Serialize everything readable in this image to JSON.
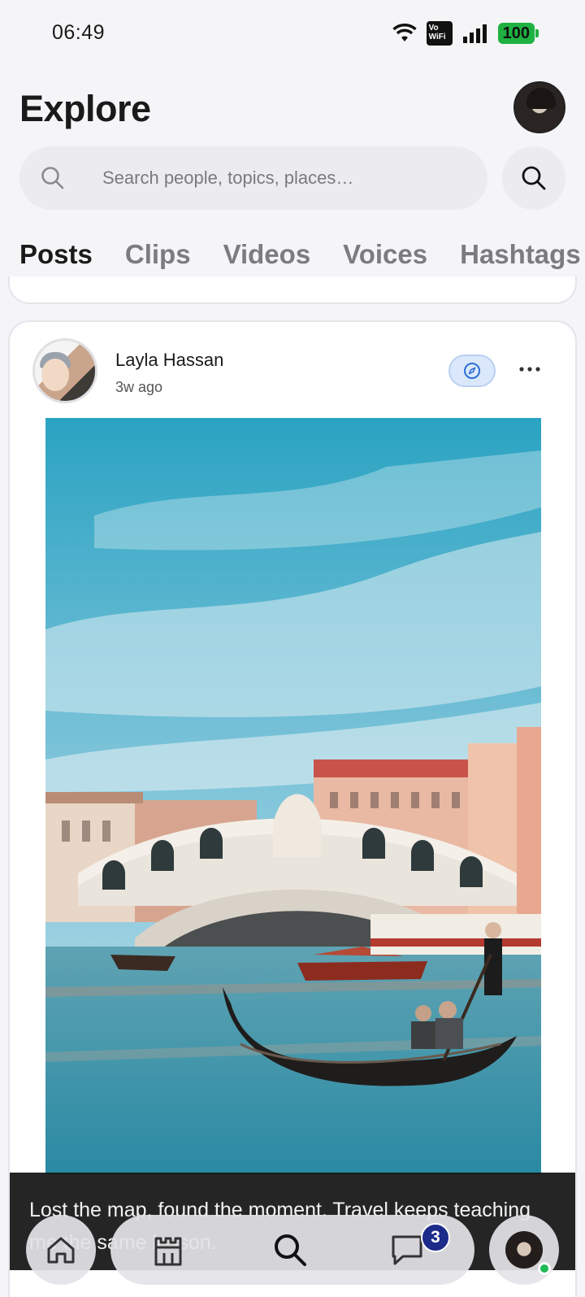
{
  "status_bar": {
    "time": "06:49",
    "network": "Vo WiFi",
    "battery": "100",
    "icons": [
      "wifi-icon",
      "vowifi-icon",
      "signal-icon",
      "battery-icon"
    ]
  },
  "header": {
    "title": "Explore",
    "search_placeholder": "Search people, topics, places…"
  },
  "tabs": [
    {
      "label": "Posts",
      "active": true
    },
    {
      "label": "Clips",
      "active": false
    },
    {
      "label": "Videos",
      "active": false
    },
    {
      "label": "Voices",
      "active": false
    },
    {
      "label": "Hashtags",
      "active": false
    }
  ],
  "post": {
    "author": "Layla Hassan",
    "time": "3w ago",
    "caption": "Lost the map, found the moment. Travel keeps teaching me the same lesson."
  },
  "nav": {
    "items": [
      "home-icon",
      "castle-icon",
      "search-icon",
      "chat-icon",
      "profile-avatar"
    ],
    "messages_badge": "3"
  },
  "colors": {
    "accent": "#1c2a8a",
    "battery": "#1fb141",
    "online": "#1db954"
  }
}
